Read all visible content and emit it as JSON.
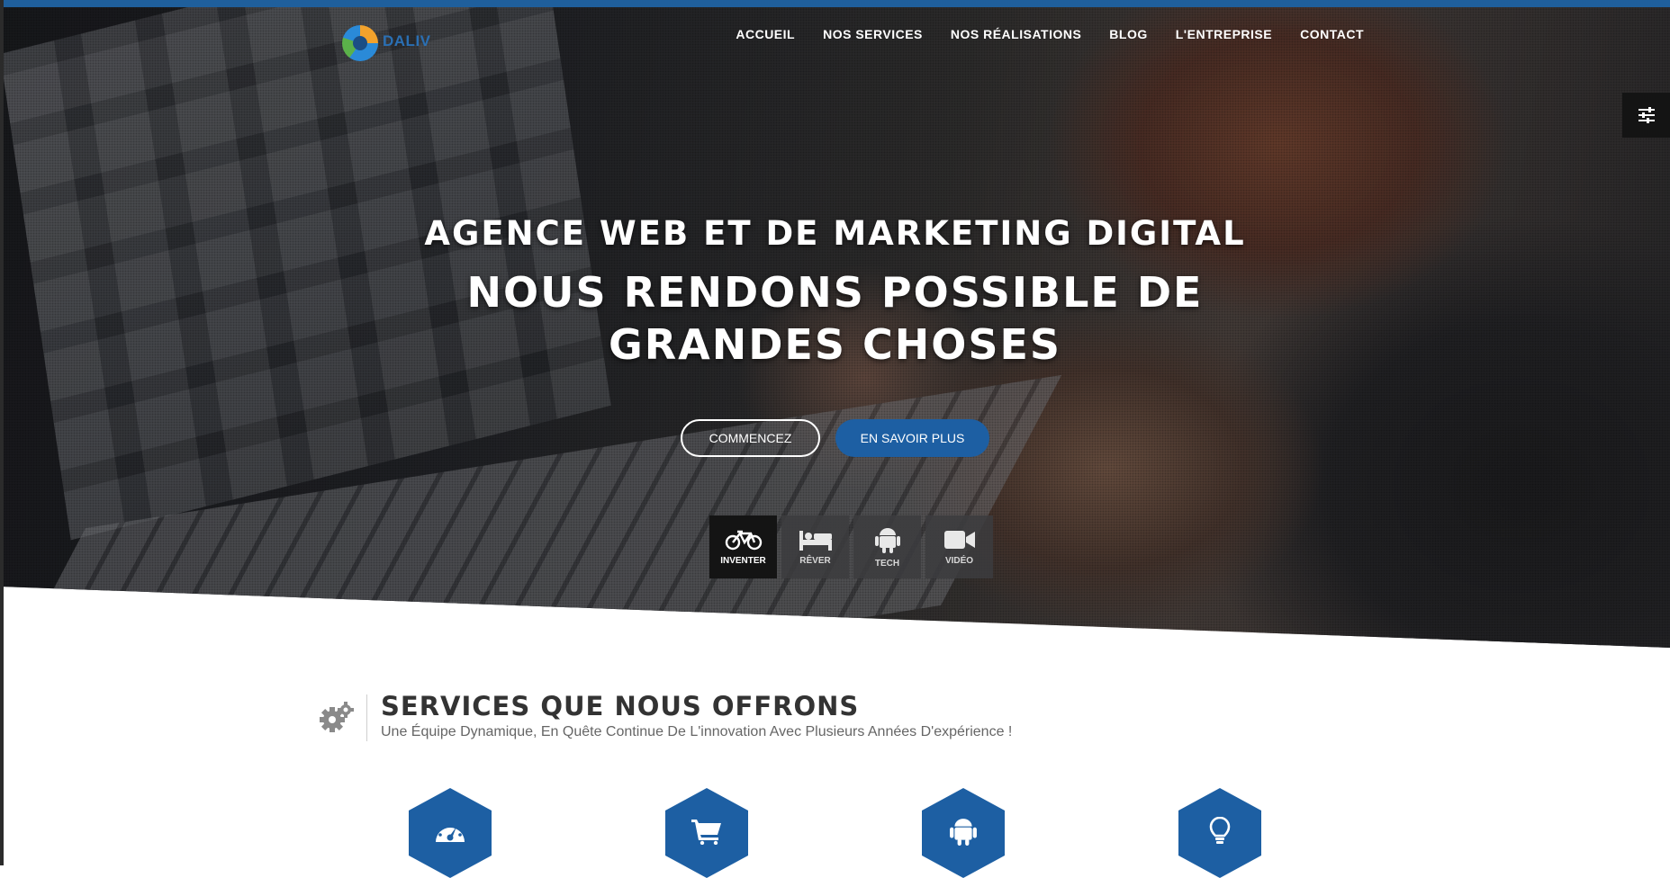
{
  "brand": {
    "logo_text": "DALIV"
  },
  "nav": {
    "items": [
      {
        "label": "ACCUEIL"
      },
      {
        "label": "NOS SERVICES"
      },
      {
        "label": "NOS RÉALISATIONS"
      },
      {
        "label": "BLOG"
      },
      {
        "label": "L'ENTREPRISE"
      },
      {
        "label": "CONTACT"
      }
    ]
  },
  "hero": {
    "title": "AGENCE WEB ET DE MARKETING DIGITAL",
    "headline_line1": "NOUS RENDONS POSSIBLE DE",
    "headline_line2": "GRANDES CHOSES",
    "primary_button": "COMMENCEZ",
    "secondary_button": "EN SAVOIR PLUS",
    "tabs": [
      {
        "label": "INVENTER",
        "icon": "bicycle-icon",
        "active": true
      },
      {
        "label": "RÊVER",
        "icon": "bed-icon",
        "active": false
      },
      {
        "label": "TECH",
        "icon": "android-icon",
        "active": false
      },
      {
        "label": "VIDÉO",
        "icon": "video-camera-icon",
        "active": false
      }
    ]
  },
  "services": {
    "title": "SERVICES QUE NOUS OFFRONS",
    "subtitle": "Une Équipe Dynamique, En Quête Continue De L'innovation Avec Plusieurs Années D'expérience !",
    "icons": [
      "dashboard-icon",
      "shopping-cart-icon",
      "android-icon",
      "lightbulb-icon"
    ]
  },
  "colors": {
    "accent": "#1d5fa3",
    "topbar": "#1f5f9c",
    "dark": "#141414"
  }
}
